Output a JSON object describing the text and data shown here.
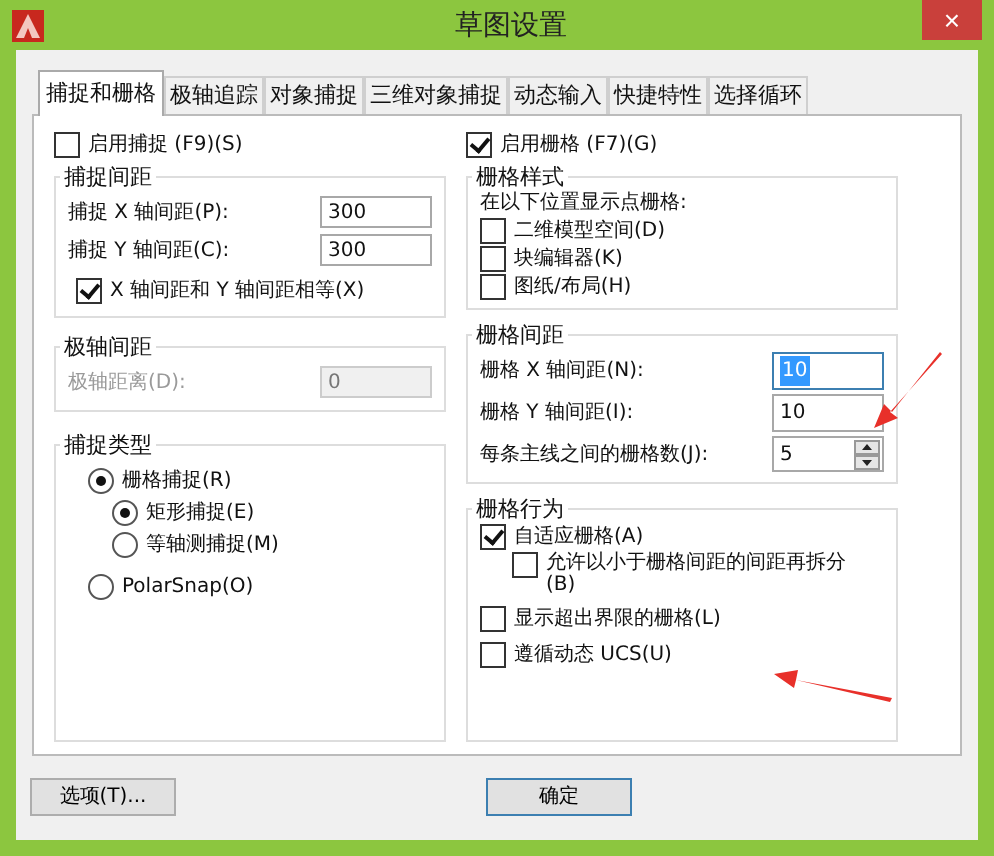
{
  "window": {
    "title": "草图设置",
    "close": "×"
  },
  "tabs": [
    {
      "label": "捕捉和栅格",
      "selected": true
    },
    {
      "label": "极轴追踪",
      "selected": false
    },
    {
      "label": "对象捕捉",
      "selected": false
    },
    {
      "label": "三维对象捕捉",
      "selected": false
    },
    {
      "label": "动态输入",
      "selected": false
    },
    {
      "label": "快捷特性",
      "selected": false
    },
    {
      "label": "选择循环",
      "selected": false
    }
  ],
  "snap": {
    "enable": {
      "label": "启用捕捉 (F9)(S)",
      "checked": false
    },
    "spacing": {
      "title": "捕捉间距",
      "fields": [
        {
          "label": "捕捉 X 轴间距(P):",
          "value": "300"
        },
        {
          "label": "捕捉 Y 轴间距(C):",
          "value": "300"
        }
      ],
      "equal": {
        "label": "X 轴间距和 Y 轴间距相等(X)",
        "checked": true
      }
    },
    "polar": {
      "title": "极轴间距",
      "field": {
        "label": "极轴距离(D):",
        "value": "0",
        "disabled": true
      }
    },
    "type": {
      "title": "捕捉类型",
      "options": [
        {
          "label": "栅格捕捉(R)",
          "selected": true,
          "children": [
            {
              "label": "矩形捕捉(E)",
              "selected": true
            },
            {
              "label": "等轴测捕捉(M)",
              "selected": false
            }
          ]
        },
        {
          "label": "PolarSnap(O)",
          "selected": false
        }
      ]
    }
  },
  "grid": {
    "enable": {
      "label": "启用栅格 (F7)(G)",
      "checked": true
    },
    "style": {
      "title": "栅格样式",
      "caption": "在以下位置显示点栅格:",
      "options": [
        {
          "label": "二维模型空间(D)",
          "checked": false
        },
        {
          "label": "块编辑器(K)",
          "checked": false
        },
        {
          "label": "图纸/布局(H)",
          "checked": false
        }
      ]
    },
    "spacing": {
      "title": "栅格间距",
      "fields": [
        {
          "kind": "text",
          "label": "栅格 X 轴间距(N):",
          "value": "10",
          "text_selected": true
        },
        {
          "kind": "text",
          "label": "栅格 Y 轴间距(I):",
          "value": "10",
          "text_selected": false
        },
        {
          "kind": "spinner",
          "label": "每条主线之间的栅格数(J):",
          "value": "5",
          "text_selected": false
        }
      ]
    },
    "behavior": {
      "title": "栅格行为",
      "options": [
        {
          "label": "自适应栅格(A)",
          "checked": true,
          "children": [
            {
              "label": "允许以小于栅格间距的间距再拆分(B)",
              "checked": false
            }
          ]
        },
        {
          "label": "显示超出界限的栅格(L)",
          "checked": false
        },
        {
          "label": "遵循动态 UCS(U)",
          "checked": false
        }
      ]
    }
  },
  "buttons": [
    {
      "label": "选项(T)...",
      "default": false
    },
    {
      "label": "确定",
      "default": true
    }
  ]
}
